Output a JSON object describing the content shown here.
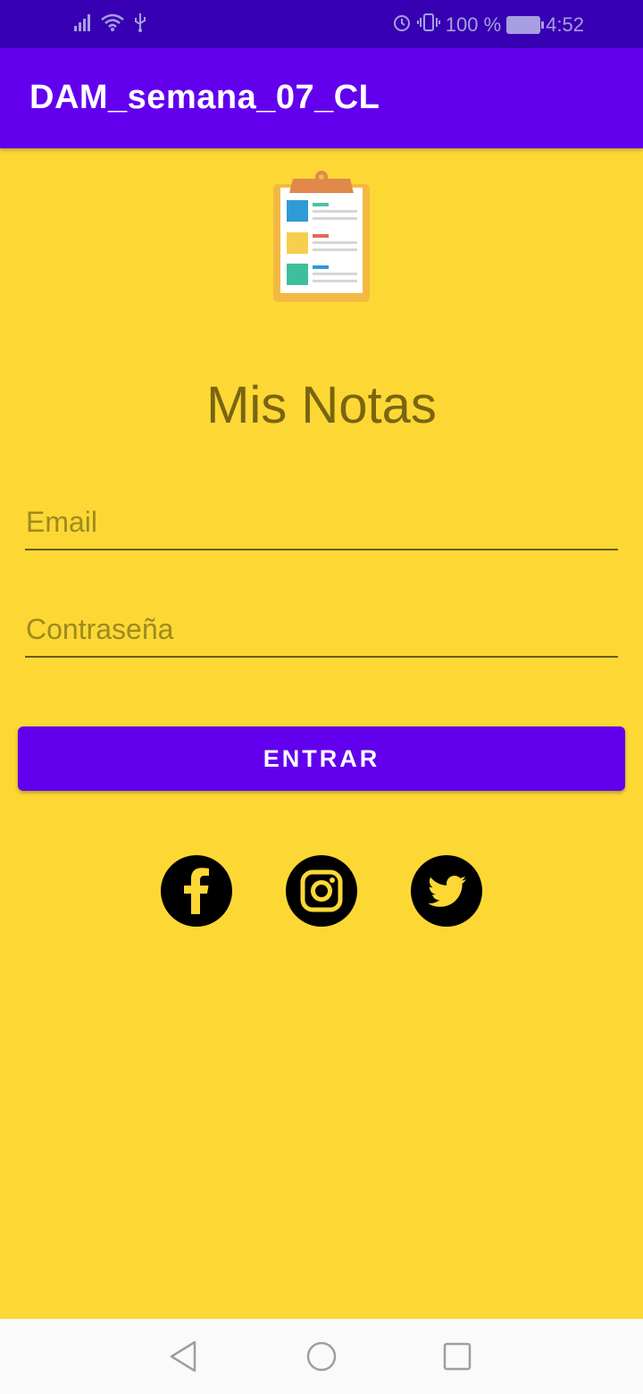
{
  "status_bar": {
    "battery_percent": "100 %",
    "time": "4:52",
    "icons": [
      "signal-icon",
      "wifi-icon",
      "usb-icon",
      "alarm-icon",
      "vibrate-icon",
      "battery-charging-icon"
    ]
  },
  "app_bar": {
    "title": "DAM_semana_07_CL"
  },
  "logo": {
    "icon": "clipboard-notes-icon"
  },
  "login": {
    "title": "Mis Notas",
    "email_placeholder": "Email",
    "password_placeholder": "Contraseña",
    "submit_label": "ENTRAR"
  },
  "social": [
    "facebook-icon",
    "instagram-icon",
    "twitter-icon"
  ],
  "nav_bar": [
    "back-icon",
    "home-icon",
    "recents-icon"
  ],
  "colors": {
    "primary": "#6200EE",
    "primary_dark": "#3700B3",
    "background": "#FDD835",
    "title_text": "#7A6410"
  }
}
